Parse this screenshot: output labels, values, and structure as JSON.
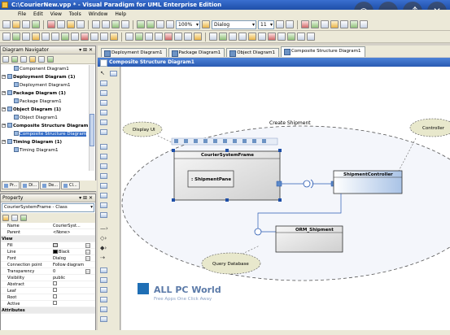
{
  "window": {
    "title": "C:\\CourierNew.vpp * - Visual Paradigm for UML Enterprise Edition"
  },
  "menu": [
    "File",
    "Edit",
    "View",
    "Tools",
    "Window",
    "Help"
  ],
  "toolbar": {
    "zoom": "100%",
    "font": "Dialog",
    "size": "11"
  },
  "tabs": [
    {
      "label": "Deployment Diagram1",
      "active": false
    },
    {
      "label": "Package Diagram1",
      "active": false
    },
    {
      "label": "Object Diagram1",
      "active": false
    },
    {
      "label": "Composite Structure Diagram1",
      "active": true
    }
  ],
  "navigator": {
    "title": "Diagram Navigator",
    "items": [
      {
        "label": "Component Diagram1",
        "level": 1,
        "bold": false,
        "selected": false
      },
      {
        "label": "Deployment Diagram (1)",
        "level": 0,
        "bold": true,
        "selected": false
      },
      {
        "label": "Deployment Diagram1",
        "level": 1,
        "bold": false,
        "selected": false
      },
      {
        "label": "Package Diagram (1)",
        "level": 0,
        "bold": true,
        "selected": false
      },
      {
        "label": "Package Diagram1",
        "level": 1,
        "bold": false,
        "selected": false
      },
      {
        "label": "Object Diagram (1)",
        "level": 0,
        "bold": true,
        "selected": false
      },
      {
        "label": "Object Diagram1",
        "level": 1,
        "bold": false,
        "selected": false
      },
      {
        "label": "Composite Structure Diagram",
        "level": 0,
        "bold": true,
        "selected": false
      },
      {
        "label": "Composite Structure Diagram",
        "level": 1,
        "bold": false,
        "selected": true
      },
      {
        "label": "Timing Diagram (1)",
        "level": 0,
        "bold": true,
        "selected": false
      },
      {
        "label": "Timing Diagram1",
        "level": 1,
        "bold": false,
        "selected": false
      }
    ],
    "bottom_tabs": [
      "Pr...",
      "Di...",
      "De...",
      "Cl..."
    ]
  },
  "properties": {
    "title": "Property",
    "selected": "CourierSystemFrame - Class",
    "rows": [
      {
        "key": "Name",
        "value": "CourierSyst...",
        "cat": false
      },
      {
        "key": "Parent",
        "value": "<None>",
        "cat": false
      },
      {
        "key": "View",
        "value": "",
        "cat": true
      },
      {
        "key": "Fill",
        "value": "",
        "cat": false,
        "swatch": "#d8d8d8"
      },
      {
        "key": "Line",
        "value": "Black",
        "cat": false,
        "swatch": "#000000"
      },
      {
        "key": "Font",
        "value": "Dialog",
        "cat": false
      },
      {
        "key": "Connection point",
        "value": "Follow diagram",
        "cat": false
      },
      {
        "key": "Transparency",
        "value": "0",
        "cat": false
      },
      {
        "key": "Visibility",
        "value": "public",
        "cat": false
      },
      {
        "key": "Abstract",
        "value": "",
        "cat": false,
        "check": true
      },
      {
        "key": "Leaf",
        "value": "",
        "cat": false,
        "check": true
      },
      {
        "key": "Root",
        "value": "",
        "cat": false,
        "check": true
      },
      {
        "key": "Active",
        "value": "",
        "cat": false,
        "check": true
      },
      {
        "key": "Attributes",
        "value": "",
        "cat": true
      }
    ]
  },
  "diagram": {
    "header": "Composite Structure Diagram1",
    "collaboration": "Create Shipment",
    "frame_title": "CourierSystemFrame",
    "part": ": ShipmentPane",
    "controller_class": "ShipmentController",
    "orm_class": "ORM_Shipment",
    "notes": {
      "display": "Display UI",
      "controller": "Controller",
      "query": "Query Database"
    }
  },
  "watermark": {
    "title": "ALL PC World",
    "subtitle": "Free Apps One Click Away"
  },
  "colors": {
    "title_blue": "#2a5ab2",
    "class_blue": "#b8cce8",
    "note_fill": "#e8e8cc"
  }
}
